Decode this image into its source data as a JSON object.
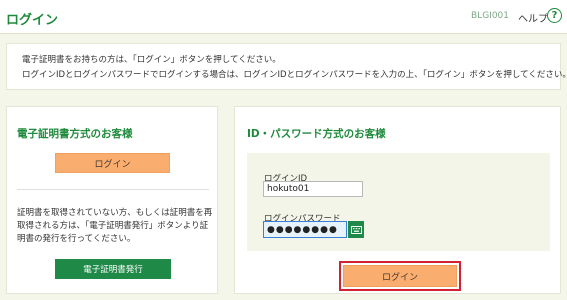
{
  "header": {
    "title": "ログイン",
    "screen_id": "BLGI001",
    "help_label": "ヘルプ",
    "help_icon_glyph": "?"
  },
  "notice": {
    "line1": "電子証明書をお持ちの方は、「ログイン」ボタンを押してください。",
    "line2": "ログインIDとログインパスワードでログインする場合は、ログインIDとログインパスワードを入力の上、「ログイン」ボタンを押してください。"
  },
  "certificate_panel": {
    "title": "電子証明書方式のお客様",
    "login_label": "ログイン",
    "description": "証明書を取得されていない方、もしくは証明書を再取得される方は、「電子証明書発行」ボタンより証明書の発行を行ってください。",
    "issue_label": "電子証明書発行"
  },
  "password_panel": {
    "title": "ID・パスワード方式のお客様",
    "login_id_label": "ログインID",
    "login_id_value": "hokuto01",
    "password_label": "ログインパスワード",
    "password_value": "●●●●●●●●",
    "keyboard_icon": "keyboard-icon",
    "login_label": "ログイン"
  },
  "colors": {
    "brand_green": "#1f8a3c",
    "button_orange": "#f9ad6e",
    "highlight_red": "#d22130",
    "background": "#f4f6ea"
  }
}
